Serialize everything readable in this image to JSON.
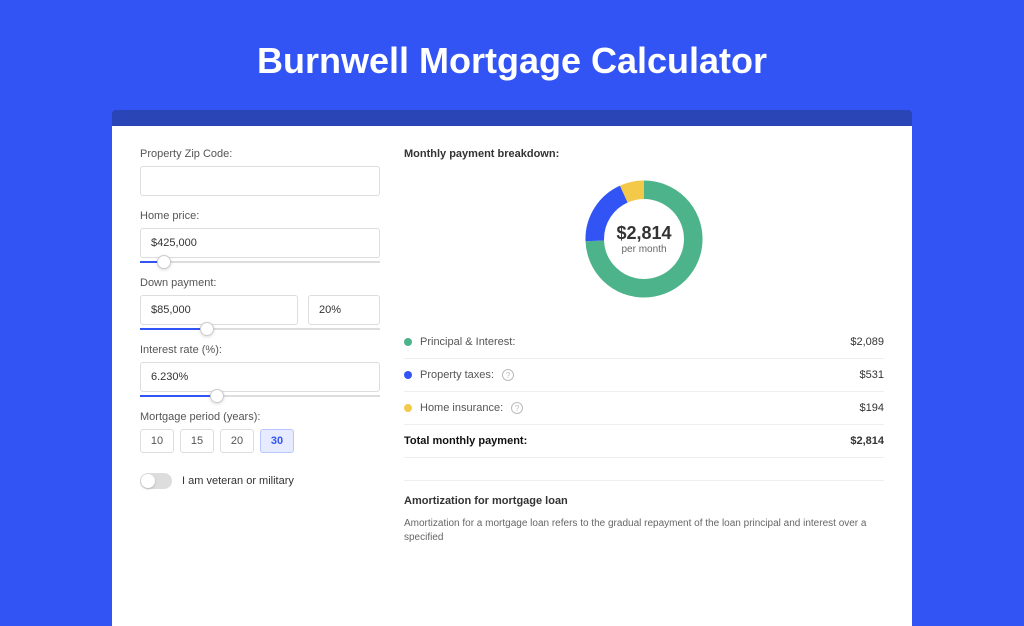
{
  "title": "Burnwell Mortgage Calculator",
  "form": {
    "zip_label": "Property Zip Code:",
    "zip_value": "",
    "home_price_label": "Home price:",
    "home_price_value": "$425,000",
    "home_price_slider_pct": 10,
    "down_payment_label": "Down payment:",
    "down_payment_value": "$85,000",
    "down_payment_pct": "20%",
    "down_payment_slider_pct": 28,
    "interest_label": "Interest rate (%):",
    "interest_value": "6.230%",
    "interest_slider_pct": 32,
    "period_label": "Mortgage period (years):",
    "periods": [
      "10",
      "15",
      "20",
      "30"
    ],
    "period_active": "30",
    "veteran_label": "I am veteran or military"
  },
  "breakdown": {
    "title": "Monthly payment breakdown:",
    "center_amount": "$2,814",
    "center_sub": "per month",
    "items": [
      {
        "label": "Principal & Interest:",
        "value": "$2,089",
        "color": "#4db38a",
        "info": false
      },
      {
        "label": "Property taxes:",
        "value": "$531",
        "color": "#3354f4",
        "info": true
      },
      {
        "label": "Home insurance:",
        "value": "$194",
        "color": "#f4c94a",
        "info": true
      }
    ],
    "total_label": "Total monthly payment:",
    "total_value": "$2,814"
  },
  "amort": {
    "title": "Amortization for mortgage loan",
    "text": "Amortization for a mortgage loan refers to the gradual repayment of the loan principal and interest over a specified"
  },
  "chart_data": {
    "type": "pie",
    "title": "Monthly payment breakdown",
    "categories": [
      "Principal & Interest",
      "Property taxes",
      "Home insurance"
    ],
    "values": [
      2089,
      531,
      194
    ],
    "colors": [
      "#4db38a",
      "#3354f4",
      "#f4c94a"
    ],
    "total": 2814
  }
}
